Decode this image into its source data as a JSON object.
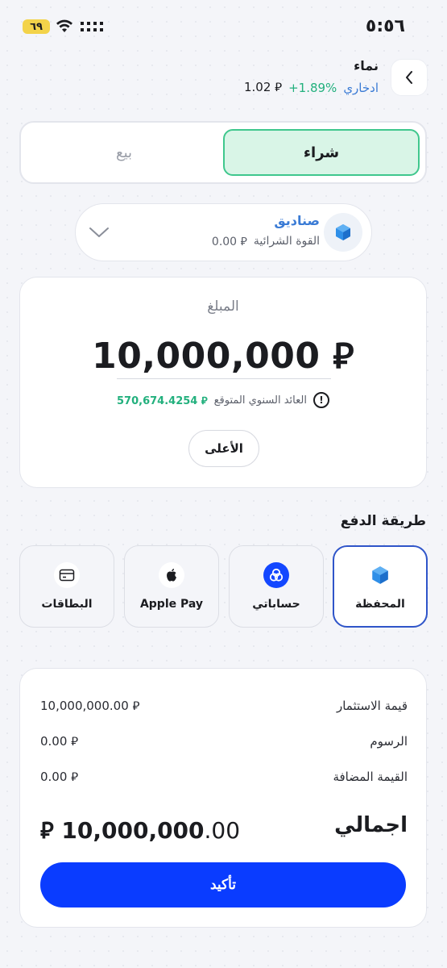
{
  "status_bar": {
    "time": "٥:٥٦",
    "battery": "٦٩"
  },
  "header": {
    "fund_name": "نماء",
    "fund_type": "ادخاري",
    "change": "+1.89%",
    "price": "1.02 ⃁"
  },
  "trade_tabs": {
    "buy": "شراء",
    "sell": "بيع",
    "selected": "buy"
  },
  "fund_selector": {
    "title": "صناديق",
    "purchasing_power_label": "القوة الشرائية",
    "purchasing_power_value": "0.00 ⃁"
  },
  "amount": {
    "label": "المبلغ",
    "value": "10,000,000 ⃁",
    "expected_return_label": "العائد السنوي المتوقع",
    "expected_return_value": "570,674.4254 ⃁",
    "info_glyph": "!",
    "max_label": "الأعلى"
  },
  "payment": {
    "title": "طريقة الدفع",
    "methods": [
      {
        "label": "المحفظة",
        "icon": "wallet-cube-icon",
        "selected": true
      },
      {
        "label": "حساباتي",
        "icon": "accounts-icon",
        "selected": false
      },
      {
        "label": "Apple Pay",
        "icon": "apple-icon",
        "selected": false
      },
      {
        "label": "البطاقات",
        "icon": "card-icon",
        "selected": false
      }
    ]
  },
  "summary": {
    "investment_label": "قيمة الاستثمار",
    "investment_value": "10,000,000.00 ⃁",
    "fees_label": "الرسوم",
    "fees_value": "0.00 ⃁",
    "vat_label": "القيمة المضافة",
    "vat_value": "0.00 ⃁",
    "total_label": "اجمالي",
    "total_integer": "10,000,000",
    "total_decimal": ".00",
    "total_currency": "⃁"
  },
  "confirm_label": "تأكيد",
  "colors": {
    "accent_blue": "#0a3cff",
    "buy_green_border": "#3fc78d",
    "positive_green": "#22b07d",
    "link_blue": "#3a7bd5"
  }
}
